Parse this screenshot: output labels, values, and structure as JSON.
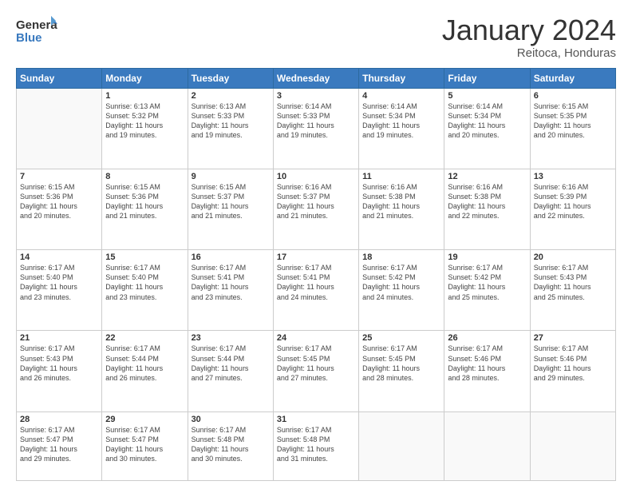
{
  "header": {
    "logo": {
      "general": "General",
      "blue": "Blue"
    },
    "title": "January 2024",
    "location": "Reitoca, Honduras"
  },
  "weekdays": [
    "Sunday",
    "Monday",
    "Tuesday",
    "Wednesday",
    "Thursday",
    "Friday",
    "Saturday"
  ],
  "weeks": [
    [
      {
        "day": "",
        "info": ""
      },
      {
        "day": "1",
        "info": "Sunrise: 6:13 AM\nSunset: 5:32 PM\nDaylight: 11 hours\nand 19 minutes."
      },
      {
        "day": "2",
        "info": "Sunrise: 6:13 AM\nSunset: 5:33 PM\nDaylight: 11 hours\nand 19 minutes."
      },
      {
        "day": "3",
        "info": "Sunrise: 6:14 AM\nSunset: 5:33 PM\nDaylight: 11 hours\nand 19 minutes."
      },
      {
        "day": "4",
        "info": "Sunrise: 6:14 AM\nSunset: 5:34 PM\nDaylight: 11 hours\nand 19 minutes."
      },
      {
        "day": "5",
        "info": "Sunrise: 6:14 AM\nSunset: 5:34 PM\nDaylight: 11 hours\nand 20 minutes."
      },
      {
        "day": "6",
        "info": "Sunrise: 6:15 AM\nSunset: 5:35 PM\nDaylight: 11 hours\nand 20 minutes."
      }
    ],
    [
      {
        "day": "7",
        "info": "Sunrise: 6:15 AM\nSunset: 5:36 PM\nDaylight: 11 hours\nand 20 minutes."
      },
      {
        "day": "8",
        "info": "Sunrise: 6:15 AM\nSunset: 5:36 PM\nDaylight: 11 hours\nand 21 minutes."
      },
      {
        "day": "9",
        "info": "Sunrise: 6:15 AM\nSunset: 5:37 PM\nDaylight: 11 hours\nand 21 minutes."
      },
      {
        "day": "10",
        "info": "Sunrise: 6:16 AM\nSunset: 5:37 PM\nDaylight: 11 hours\nand 21 minutes."
      },
      {
        "day": "11",
        "info": "Sunrise: 6:16 AM\nSunset: 5:38 PM\nDaylight: 11 hours\nand 21 minutes."
      },
      {
        "day": "12",
        "info": "Sunrise: 6:16 AM\nSunset: 5:38 PM\nDaylight: 11 hours\nand 22 minutes."
      },
      {
        "day": "13",
        "info": "Sunrise: 6:16 AM\nSunset: 5:39 PM\nDaylight: 11 hours\nand 22 minutes."
      }
    ],
    [
      {
        "day": "14",
        "info": "Sunrise: 6:17 AM\nSunset: 5:40 PM\nDaylight: 11 hours\nand 23 minutes."
      },
      {
        "day": "15",
        "info": "Sunrise: 6:17 AM\nSunset: 5:40 PM\nDaylight: 11 hours\nand 23 minutes."
      },
      {
        "day": "16",
        "info": "Sunrise: 6:17 AM\nSunset: 5:41 PM\nDaylight: 11 hours\nand 23 minutes."
      },
      {
        "day": "17",
        "info": "Sunrise: 6:17 AM\nSunset: 5:41 PM\nDaylight: 11 hours\nand 24 minutes."
      },
      {
        "day": "18",
        "info": "Sunrise: 6:17 AM\nSunset: 5:42 PM\nDaylight: 11 hours\nand 24 minutes."
      },
      {
        "day": "19",
        "info": "Sunrise: 6:17 AM\nSunset: 5:42 PM\nDaylight: 11 hours\nand 25 minutes."
      },
      {
        "day": "20",
        "info": "Sunrise: 6:17 AM\nSunset: 5:43 PM\nDaylight: 11 hours\nand 25 minutes."
      }
    ],
    [
      {
        "day": "21",
        "info": "Sunrise: 6:17 AM\nSunset: 5:43 PM\nDaylight: 11 hours\nand 26 minutes."
      },
      {
        "day": "22",
        "info": "Sunrise: 6:17 AM\nSunset: 5:44 PM\nDaylight: 11 hours\nand 26 minutes."
      },
      {
        "day": "23",
        "info": "Sunrise: 6:17 AM\nSunset: 5:44 PM\nDaylight: 11 hours\nand 27 minutes."
      },
      {
        "day": "24",
        "info": "Sunrise: 6:17 AM\nSunset: 5:45 PM\nDaylight: 11 hours\nand 27 minutes."
      },
      {
        "day": "25",
        "info": "Sunrise: 6:17 AM\nSunset: 5:45 PM\nDaylight: 11 hours\nand 28 minutes."
      },
      {
        "day": "26",
        "info": "Sunrise: 6:17 AM\nSunset: 5:46 PM\nDaylight: 11 hours\nand 28 minutes."
      },
      {
        "day": "27",
        "info": "Sunrise: 6:17 AM\nSunset: 5:46 PM\nDaylight: 11 hours\nand 29 minutes."
      }
    ],
    [
      {
        "day": "28",
        "info": "Sunrise: 6:17 AM\nSunset: 5:47 PM\nDaylight: 11 hours\nand 29 minutes."
      },
      {
        "day": "29",
        "info": "Sunrise: 6:17 AM\nSunset: 5:47 PM\nDaylight: 11 hours\nand 30 minutes."
      },
      {
        "day": "30",
        "info": "Sunrise: 6:17 AM\nSunset: 5:48 PM\nDaylight: 11 hours\nand 30 minutes."
      },
      {
        "day": "31",
        "info": "Sunrise: 6:17 AM\nSunset: 5:48 PM\nDaylight: 11 hours\nand 31 minutes."
      },
      {
        "day": "",
        "info": ""
      },
      {
        "day": "",
        "info": ""
      },
      {
        "day": "",
        "info": ""
      }
    ]
  ]
}
